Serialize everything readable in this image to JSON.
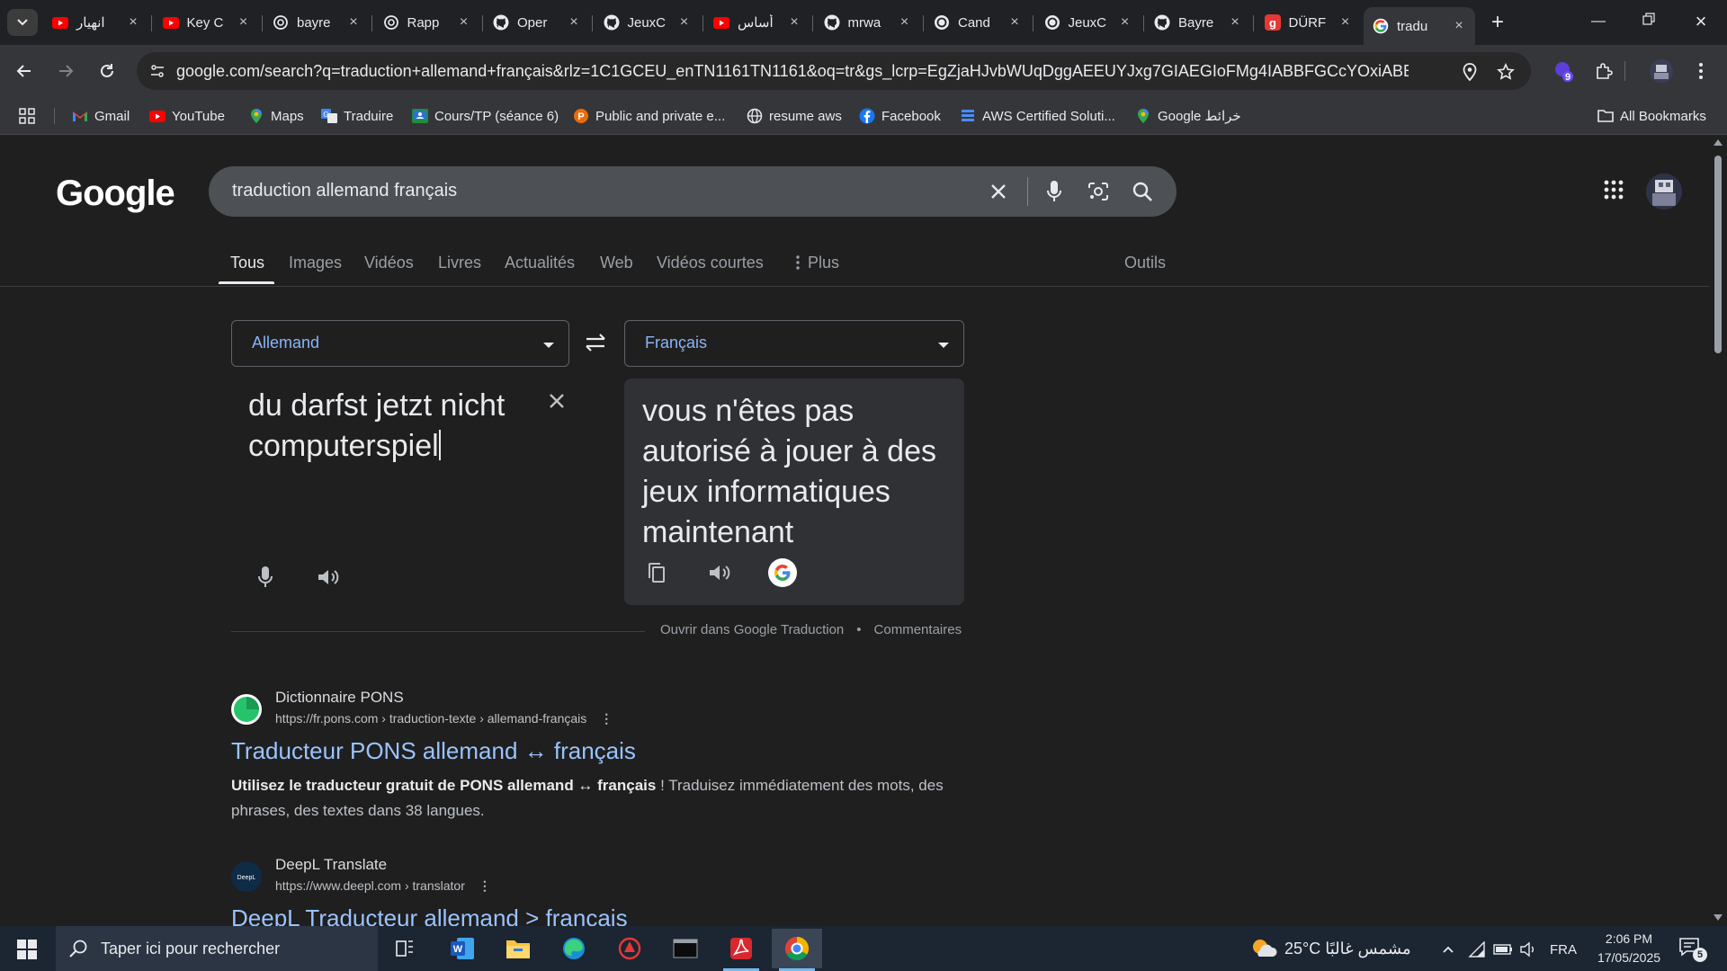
{
  "browser": {
    "tabs": [
      {
        "title": "انهيار",
        "icon": "youtube-icon",
        "active": false
      },
      {
        "title": "Key C",
        "icon": "youtube-icon",
        "active": false
      },
      {
        "title": "bayre",
        "icon": "chatgpt-icon",
        "active": false
      },
      {
        "title": "Rapp",
        "icon": "chatgpt-icon",
        "active": false
      },
      {
        "title": "Oper",
        "icon": "github-icon",
        "active": false
      },
      {
        "title": "JeuxC",
        "icon": "github-icon",
        "active": false
      },
      {
        "title": "أساس",
        "icon": "youtube-icon",
        "active": false
      },
      {
        "title": "mrwa",
        "icon": "github-icon",
        "active": false
      },
      {
        "title": "Cand",
        "icon": "openai-icon",
        "active": false
      },
      {
        "title": "JeuxC",
        "icon": "openai-icon",
        "active": false
      },
      {
        "title": "Bayre",
        "icon": "github-icon",
        "active": false
      },
      {
        "title": "DÜRF",
        "icon": "dict-icon",
        "active": false
      },
      {
        "title": "tradu",
        "icon": "google-icon",
        "active": true
      }
    ],
    "url": "google.com/search?q=traduction+allemand+français&rlz=1C1GCEU_enTN1161TN1161&oq=tr&gs_lcrp=EgZjaHJvbWUqDggAEEUYJxg7GIAEGIoFMg4IABBFGCcYOxiABBiKBTIGCAEQ...",
    "extension_badge": "9",
    "bookmarks": [
      {
        "label": "Gmail",
        "icon": "gmail-icon"
      },
      {
        "label": "YouTube",
        "icon": "youtube-icon"
      },
      {
        "label": "Maps",
        "icon": "maps-icon"
      },
      {
        "label": "Traduire",
        "icon": "translate-icon"
      },
      {
        "label": "Cours/TP (séance 6)",
        "icon": "classroom-icon"
      },
      {
        "label": "Public and private e...",
        "icon": "pearson-icon"
      },
      {
        "label": "resume aws",
        "icon": "globe-icon"
      },
      {
        "label": "Facebook",
        "icon": "facebook-icon"
      },
      {
        "label": "AWS Certified Soluti...",
        "icon": "aws-icon"
      },
      {
        "label": "Google خرائط",
        "icon": "maps-icon"
      }
    ],
    "all_bookmarks": "All Bookmarks"
  },
  "google": {
    "logo": "Google",
    "query": "traduction allemand français",
    "tabs": [
      "Tous",
      "Images",
      "Vidéos",
      "Livres",
      "Actualités",
      "Web",
      "Vidéos courtes",
      "Plus"
    ],
    "tools": "Outils",
    "translator": {
      "source_lang": "Allemand",
      "target_lang": "Français",
      "source_text": "du darfst jetzt nicht computerspiel",
      "target_text": "vous n'êtes pas autorisé à jouer à des jeux informatiques maintenant",
      "open_link": "Ouvrir dans Google Traduction",
      "feedback": "Commentaires"
    },
    "results": [
      {
        "site": "Dictionnaire PONS",
        "url": "https://fr.pons.com › traduction-texte › allemand-français",
        "title": "Traducteur PONS allemand ↔ français",
        "snippet_bold": "Utilisez le traducteur gratuit de PONS allemand ↔ français",
        "snippet_rest": " ! Traduisez immédiatement des mots, des phrases, des textes dans 38 langues."
      },
      {
        "site": "DeepL Translate",
        "url": "https://www.deepl.com › translator",
        "title": "DeepL Traducteur allemand > français",
        "snippet_bold": "",
        "snippet_rest": ""
      }
    ]
  },
  "taskbar": {
    "search_placeholder": "Taper ici pour rechercher",
    "weather": "25°C  مشمس غالبًا",
    "language": "FRA",
    "time": "2:06 PM",
    "date": "17/05/2025",
    "notifications": "5"
  },
  "colors": {
    "link": "#99c3ff",
    "lang_label": "#8ab4f8",
    "page_bg": "#1f1f1f"
  }
}
